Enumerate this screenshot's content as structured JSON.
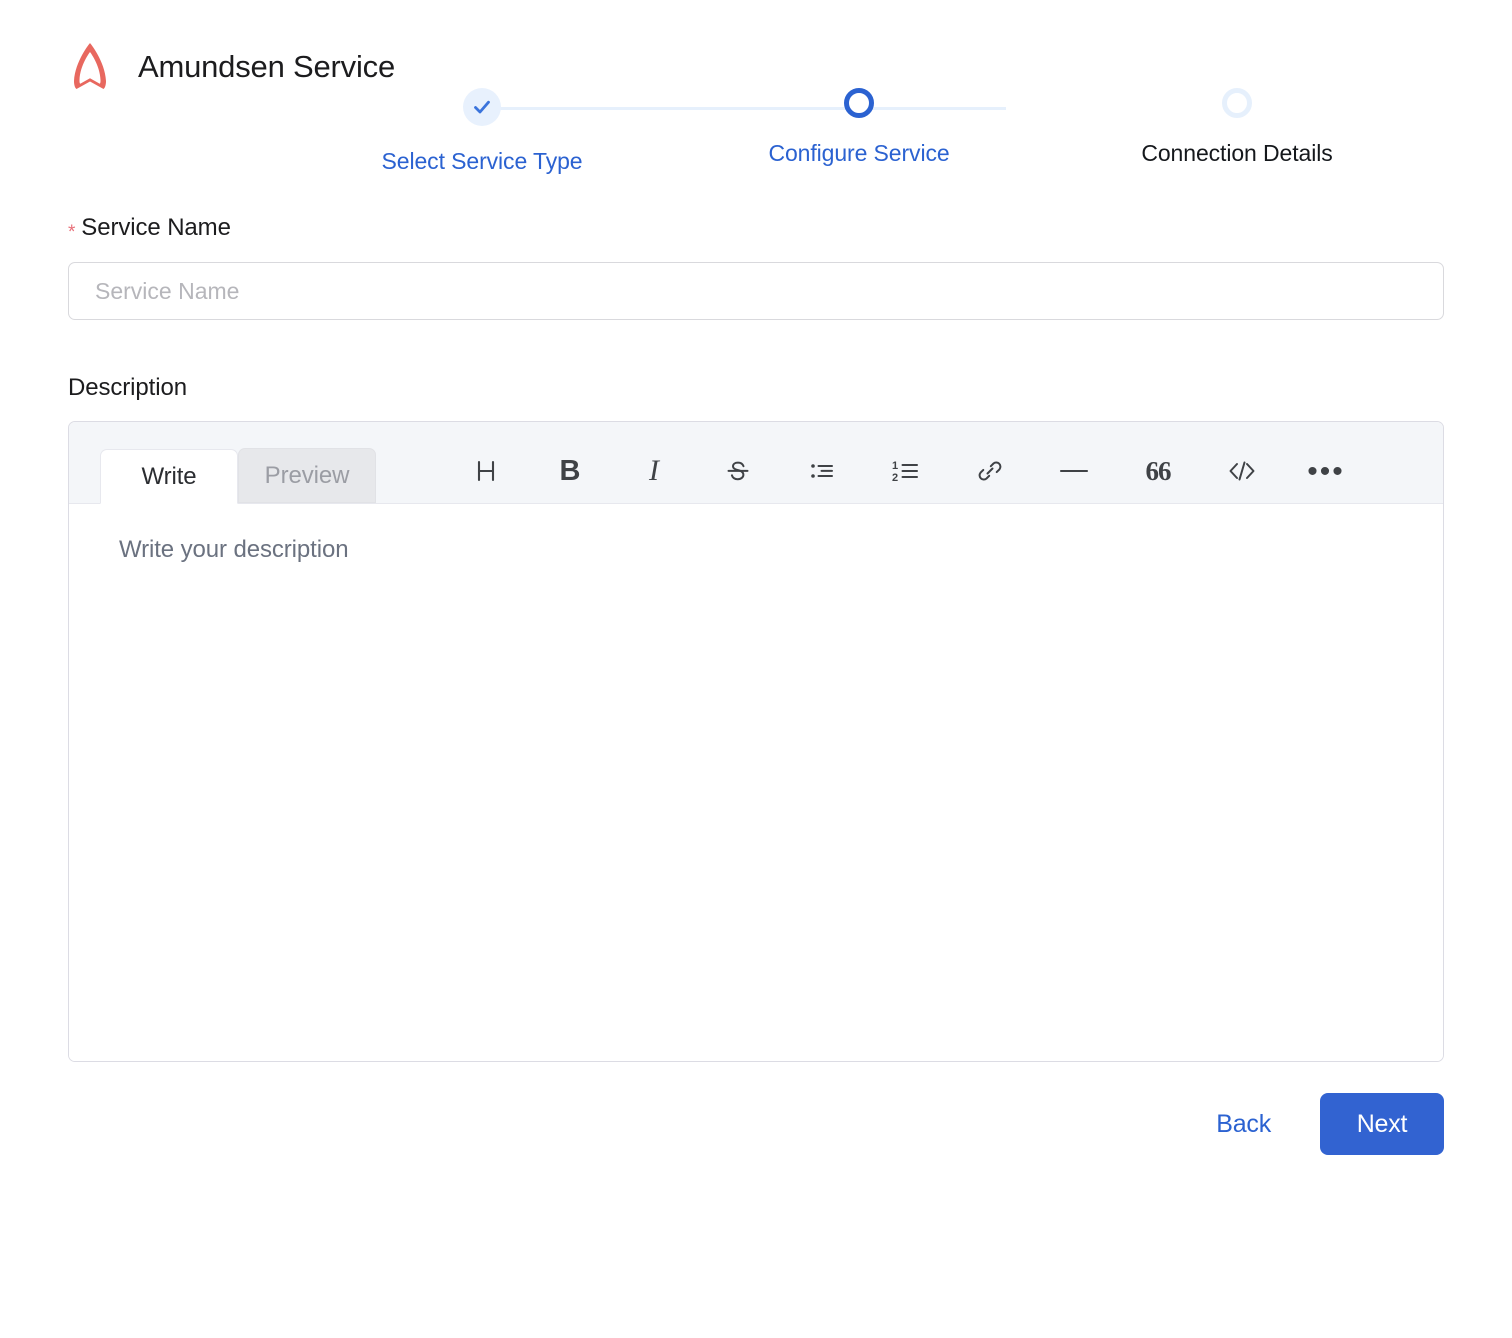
{
  "header": {
    "title": "Amundsen Service",
    "logo_icon": "amundsen-logo-icon",
    "logo_color": "#e8685f"
  },
  "stepper": {
    "steps": [
      {
        "label": "Select Service Type",
        "state": "completed",
        "marker_icon": "check-icon"
      },
      {
        "label": "Configure Service",
        "state": "active",
        "marker_icon": "circle-icon"
      },
      {
        "label": "Connection Details",
        "state": "upcoming",
        "marker_icon": "circle-icon"
      }
    ],
    "active_color": "#2b62d1",
    "track_color": "#e6f0fc"
  },
  "form": {
    "service_name": {
      "label": "Service Name",
      "required_marker": "*",
      "value": "",
      "placeholder": "Service Name"
    },
    "description": {
      "label": "Description",
      "value": "",
      "placeholder": "Write your description"
    }
  },
  "editor": {
    "tabs": [
      {
        "label": "Write",
        "active": true
      },
      {
        "label": "Preview",
        "active": false
      }
    ],
    "toolbar": [
      {
        "name": "heading-icon",
        "glyph": "H"
      },
      {
        "name": "bold-icon",
        "glyph": "B"
      },
      {
        "name": "italic-icon",
        "glyph": "I"
      },
      {
        "name": "strikethrough-icon",
        "glyph": "S"
      },
      {
        "name": "bullet-list-icon",
        "glyph": ""
      },
      {
        "name": "numbered-list-icon",
        "glyph": ""
      },
      {
        "name": "link-icon",
        "glyph": ""
      },
      {
        "name": "horizontal-rule-icon",
        "glyph": ""
      },
      {
        "name": "blockquote-icon",
        "glyph": "66"
      },
      {
        "name": "code-icon",
        "glyph": "</>"
      },
      {
        "name": "more-options-icon",
        "glyph": "•••"
      }
    ]
  },
  "footer": {
    "back_label": "Back",
    "next_label": "Next",
    "next_color": "#3263d1",
    "back_color": "#2b62d1"
  }
}
